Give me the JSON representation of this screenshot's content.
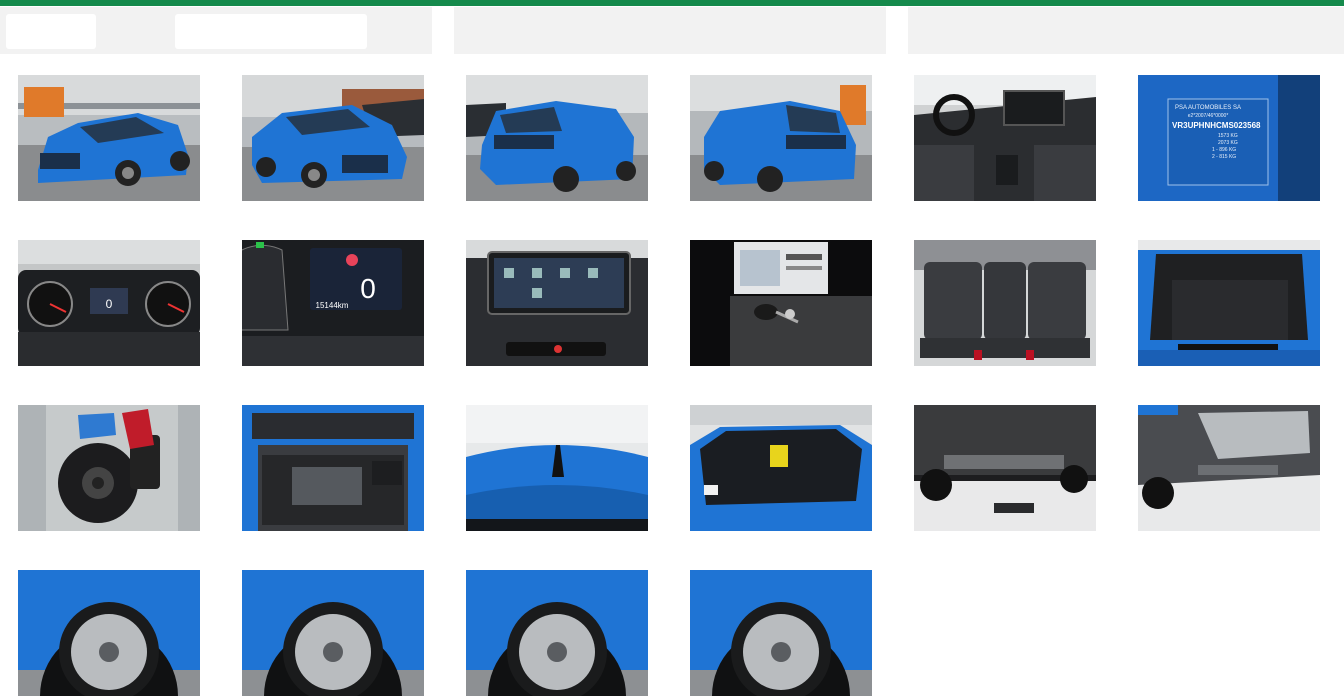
{
  "colors": {
    "accent_bar": "#158a4c",
    "header_bg": "#f2f2f2",
    "car_blue": "#1f74d4"
  },
  "header": {
    "field_a_value": "",
    "field_b_value": ""
  },
  "gallery": {
    "photos": [
      {
        "id": "front-left-exterior",
        "icon": "car-front-left-icon"
      },
      {
        "id": "front-right-exterior",
        "icon": "car-front-right-icon"
      },
      {
        "id": "rear-left-exterior",
        "icon": "car-rear-left-icon"
      },
      {
        "id": "rear-right-exterior",
        "icon": "car-rear-right-icon"
      },
      {
        "id": "interior-dashboard",
        "icon": "dashboard-icon"
      },
      {
        "id": "vin-plate",
        "icon": "vin-plate-icon"
      },
      {
        "id": "instrument-cluster",
        "icon": "gauge-icon"
      },
      {
        "id": "odometer-display",
        "icon": "odometer-icon"
      },
      {
        "id": "infotainment-screen",
        "icon": "screen-icon"
      },
      {
        "id": "keys-and-manual",
        "icon": "key-icon"
      },
      {
        "id": "rear-seats",
        "icon": "seat-icon"
      },
      {
        "id": "trunk",
        "icon": "trunk-icon"
      },
      {
        "id": "spare-wheel-well",
        "icon": "spare-wheel-icon"
      },
      {
        "id": "engine-bay",
        "icon": "engine-icon"
      },
      {
        "id": "roof-antenna",
        "icon": "antenna-icon"
      },
      {
        "id": "windshield",
        "icon": "windshield-icon"
      },
      {
        "id": "underbody-front",
        "icon": "underbody-icon"
      },
      {
        "id": "underbody-rear",
        "icon": "underbody-icon"
      },
      {
        "id": "wheel-front-left",
        "icon": "wheel-icon"
      },
      {
        "id": "wheel-front-right",
        "icon": "wheel-icon"
      },
      {
        "id": "wheel-rear-left",
        "icon": "wheel-icon"
      },
      {
        "id": "wheel-rear-right",
        "icon": "wheel-icon"
      }
    ],
    "vin_plate_text": {
      "line1": "PSA AUTOMOBILES SA",
      "line2": "e2*2007/46*0000*",
      "line3": "VR3UPHNHCMS023568",
      "line4": "1573 KG",
      "line5": "2073 KG",
      "line6": "1 - 896 KG",
      "line7": "2 - 815 KG"
    },
    "odometer_text": {
      "speed": "0",
      "mileage": "15144km"
    },
    "cluster_text": {
      "speed": "0"
    }
  }
}
